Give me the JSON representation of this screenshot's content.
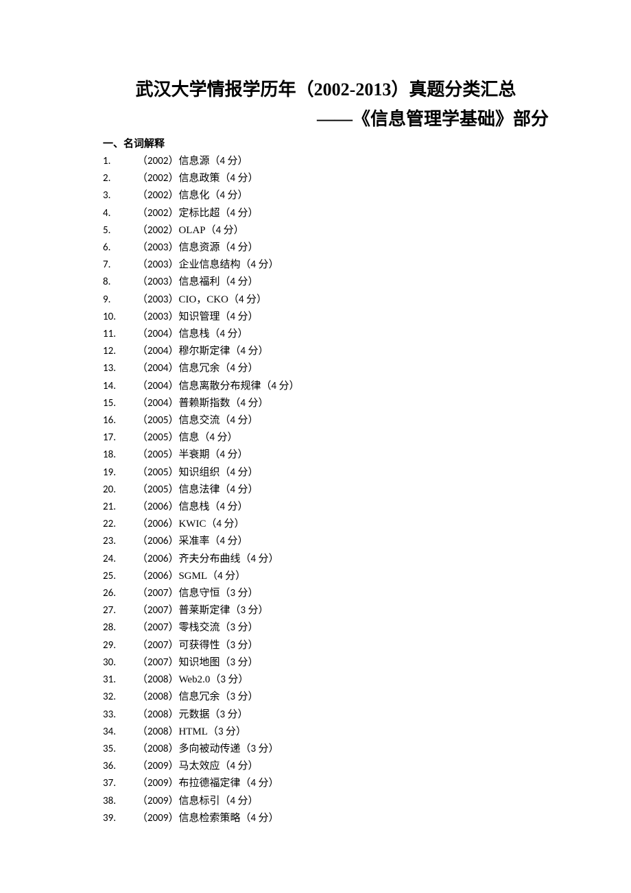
{
  "title_line1": "武汉大学情报学历年（2002-2013）真题分类汇总",
  "title_line2": "——《信息管理学基础》部分",
  "section_heading": "一、名词解释",
  "items": [
    {
      "n": "1.",
      "y": "2002",
      "t": "信息源",
      "p": "4 分"
    },
    {
      "n": "2.",
      "y": "2002",
      "t": "信息政策",
      "p": "4 分"
    },
    {
      "n": "3.",
      "y": "2002",
      "t": "信息化",
      "p": "4 分"
    },
    {
      "n": "4.",
      "y": "2002",
      "t": "定标比超",
      "p": "4 分"
    },
    {
      "n": "5.",
      "y": "2002",
      "t": "OLAP",
      "p": "4 分"
    },
    {
      "n": "6.",
      "y": "2003",
      "t": "信息资源",
      "p": "4 分"
    },
    {
      "n": "7.",
      "y": "2003",
      "t": "企业信息结构",
      "p": "4 分"
    },
    {
      "n": "8.",
      "y": "2003",
      "t": "信息福利",
      "p": "4 分"
    },
    {
      "n": "9.",
      "y": "2003",
      "t": "CIO，CKO",
      "p": "4 分"
    },
    {
      "n": "10.",
      "y": "2003",
      "t": "知识管理",
      "p": "4 分"
    },
    {
      "n": "11.",
      "y": "2004",
      "t": "信息栈",
      "p": "4 分"
    },
    {
      "n": "12.",
      "y": "2004",
      "t": "穆尔斯定律",
      "p": "4 分"
    },
    {
      "n": "13.",
      "y": "2004",
      "t": "信息冗余",
      "p": "4 分"
    },
    {
      "n": "14.",
      "y": "2004",
      "t": "信息离散分布规律",
      "p": "4 分"
    },
    {
      "n": "15.",
      "y": "2004",
      "t": "普赖斯指数",
      "p": "4 分"
    },
    {
      "n": "16.",
      "y": "2005",
      "t": "信息交流",
      "p": "4 分"
    },
    {
      "n": "17.",
      "y": "2005",
      "t": "信息",
      "p": "4 分"
    },
    {
      "n": "18.",
      "y": "2005",
      "t": "半衰期",
      "p": "4 分"
    },
    {
      "n": "19.",
      "y": "2005",
      "t": "知识组织",
      "p": "4 分"
    },
    {
      "n": "20.",
      "y": "2005",
      "t": "信息法律",
      "p": "4 分"
    },
    {
      "n": "21.",
      "y": "2006",
      "t": "信息栈",
      "p": "4 分"
    },
    {
      "n": "22.",
      "y": "2006",
      "t": "KWIC",
      "p": "4 分"
    },
    {
      "n": "23.",
      "y": "2006",
      "t": "采准率",
      "p": "4 分"
    },
    {
      "n": "24.",
      "y": "2006",
      "t": "齐夫分布曲线",
      "p": "4 分"
    },
    {
      "n": "25.",
      "y": "2006",
      "t": "SGML",
      "p": "4 分"
    },
    {
      "n": "26.",
      "y": "2007",
      "t": "信息守恒",
      "p": "3 分"
    },
    {
      "n": "27.",
      "y": "2007",
      "t": "普莱斯定律",
      "p": "3 分"
    },
    {
      "n": "28.",
      "y": "2007",
      "t": "零栈交流",
      "p": "3 分"
    },
    {
      "n": "29.",
      "y": "2007",
      "t": "可获得性",
      "p": "3 分"
    },
    {
      "n": "30.",
      "y": "2007",
      "t": "知识地图",
      "p": "3 分"
    },
    {
      "n": "31.",
      "y": "2008",
      "t": "Web2.0",
      "p": "3 分"
    },
    {
      "n": "32.",
      "y": "2008",
      "t": "信息冗余",
      "p": "3 分"
    },
    {
      "n": "33.",
      "y": "2008",
      "t": "元数据",
      "p": "3 分"
    },
    {
      "n": "34.",
      "y": "2008",
      "t": "HTML",
      "p": "3 分"
    },
    {
      "n": "35.",
      "y": "2008",
      "t": "多向被动传递",
      "p": "3 分"
    },
    {
      "n": "36.",
      "y": "2009",
      "t": "马太效应",
      "p": "4 分"
    },
    {
      "n": "37.",
      "y": "2009",
      "t": "布拉德福定律",
      "p": "4 分"
    },
    {
      "n": "38.",
      "y": "2009",
      "t": "信息标引",
      "p": "4 分"
    },
    {
      "n": "39.",
      "y": "2009",
      "t": "信息检索策略",
      "p": "4 分"
    }
  ]
}
